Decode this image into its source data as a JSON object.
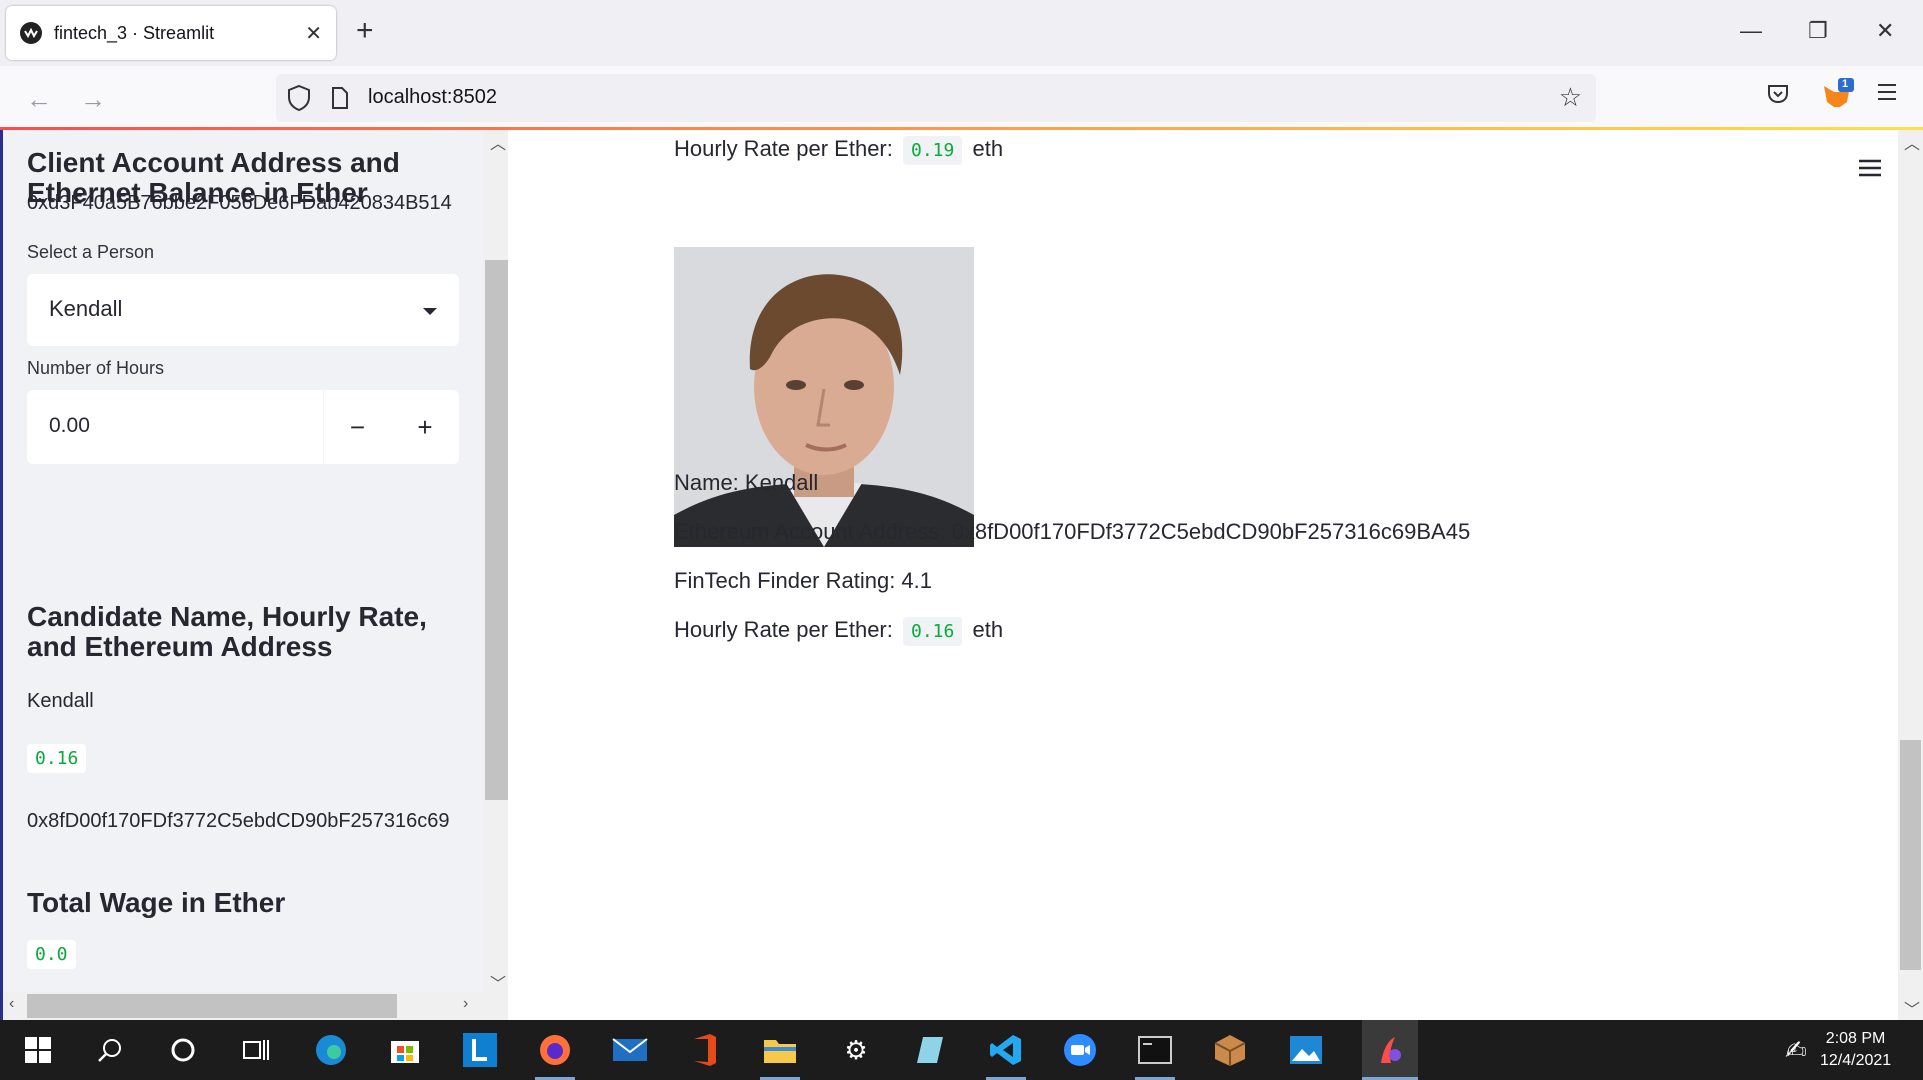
{
  "browser": {
    "tab_title": "fintech_3 · Streamlit",
    "url": "localhost:8502",
    "extension_badge": "1"
  },
  "sidebar": {
    "account_heading": "Client Account Address and Ethernet Balance in Ether",
    "account_address": "0xd3F40a5B76bbe2F056De6FDab420834B514",
    "select_label": "Select a Person",
    "select_value": "Kendall",
    "hours_label": "Number of Hours",
    "hours_value": "0.00",
    "minus_label": "−",
    "plus_label": "+",
    "candidate_heading": "Candidate Name, Hourly Rate, and Ethereum Address",
    "candidate_name": "Kendall",
    "candidate_rate": "0.16",
    "candidate_address": "0x8fD00f170FDf3772C5ebdCD90bF257316c69",
    "wage_heading": "Total Wage in Ether",
    "wage_value": "0.0"
  },
  "main": {
    "top_rate_label": "Hourly Rate per Ether:",
    "top_rate_value": "0.19",
    "top_rate_unit": "eth",
    "name_line": "Name: Kendall",
    "address_line": "Ethereum Account Address: 0x8fD00f170FDf3772C5ebdCD90bF257316c69BA45",
    "rating_line": "FinTech Finder Rating: 4.1",
    "rate_label": "Hourly Rate per Ether:",
    "rate_value": "0.16",
    "rate_unit": "eth"
  },
  "taskbar": {
    "time": "2:08 PM",
    "date": "12/4/2021"
  },
  "colors": {
    "accent_red": "#ff4b4b",
    "code_green": "#09ab3b",
    "sidebar_bg": "#f0f2f6"
  }
}
